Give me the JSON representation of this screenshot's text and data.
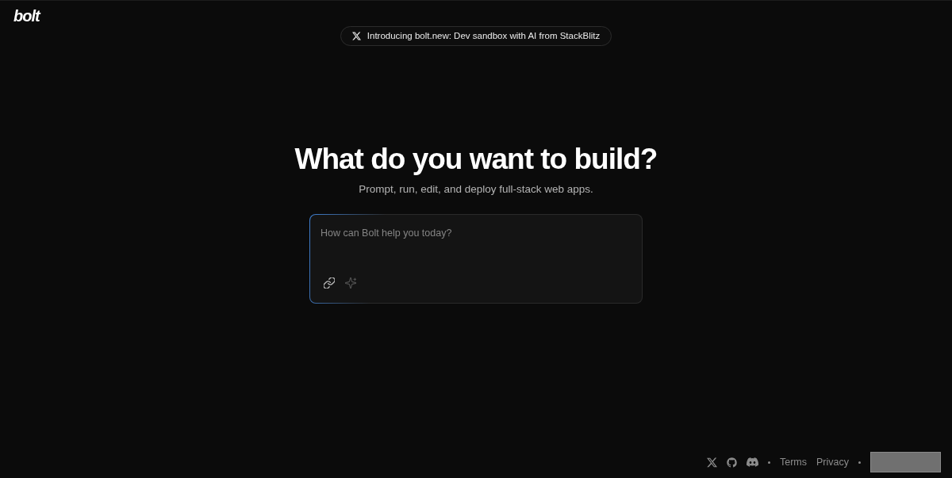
{
  "logo": {
    "text": "bolt"
  },
  "announcement": {
    "text": "Introducing bolt.new: Dev sandbox with AI from StackBlitz"
  },
  "hero": {
    "title": "What do you want to build?",
    "subtitle": "Prompt, run, edit, and deploy full-stack web apps."
  },
  "prompt": {
    "placeholder": "How can Bolt help you today?",
    "tools": [
      {
        "kind": "attach",
        "disabled": false
      },
      {
        "kind": "enhance",
        "disabled": true
      }
    ]
  },
  "footer": {
    "social": [
      {
        "kind": "x"
      },
      {
        "kind": "github"
      },
      {
        "kind": "discord"
      }
    ],
    "links": [
      "Terms",
      "Privacy"
    ]
  }
}
